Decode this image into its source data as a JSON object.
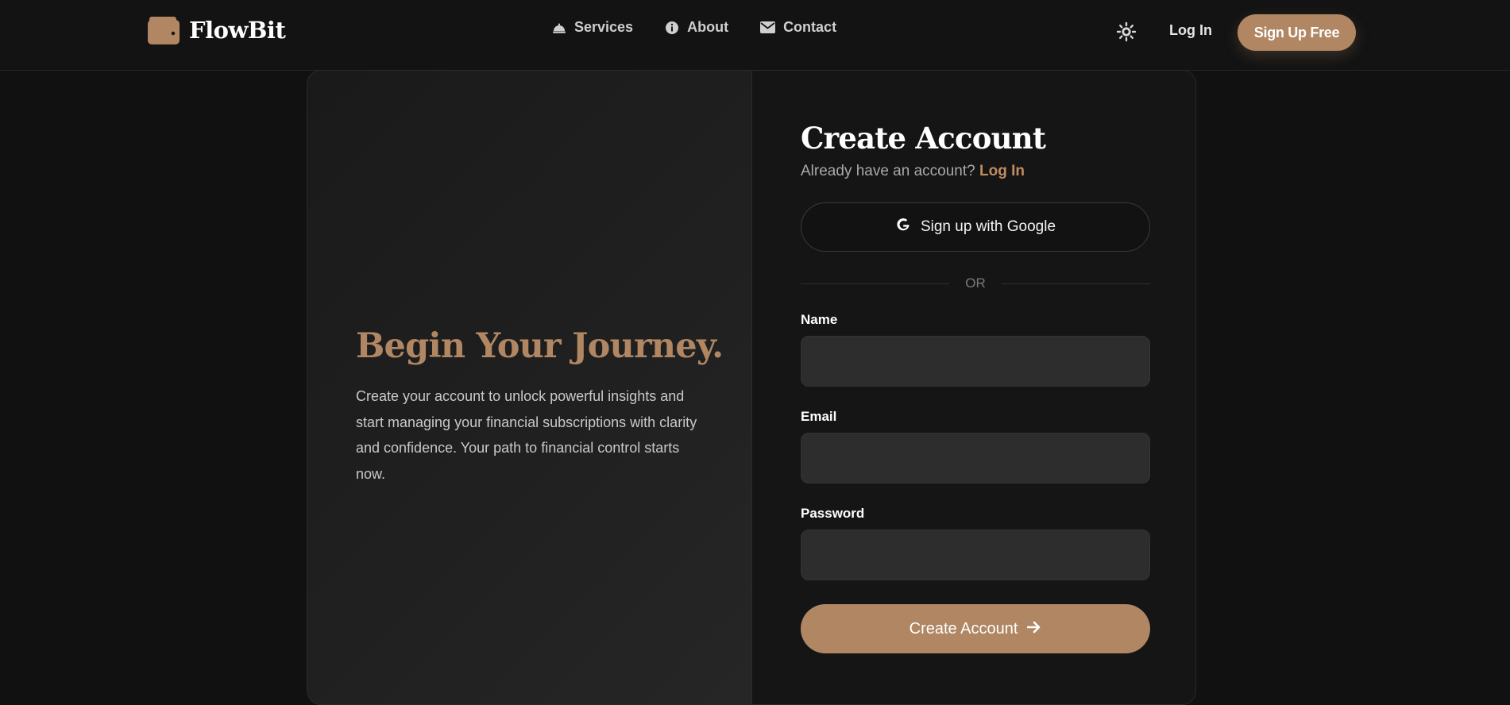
{
  "brand": {
    "name": "FlowBit",
    "icon": "wallet-icon",
    "accent_color": "#b08663"
  },
  "nav": {
    "items": [
      {
        "label": "Services",
        "icon": "bell-service-icon"
      },
      {
        "label": "About",
        "icon": "info-circle-icon"
      },
      {
        "label": "Contact",
        "icon": "envelope-icon"
      }
    ],
    "theme_toggle_icon": "sun-icon",
    "login_label": "Log In",
    "signup_label": "Sign Up Free"
  },
  "hero": {
    "title": "Begin Your Journey.",
    "text": "Create your account to unlock powerful insights and start managing your financial subscriptions with clarity and confidence. Your path to financial control starts now."
  },
  "form": {
    "title": "Create Account",
    "login_prompt": "Already have an account?",
    "login_link": "Log In",
    "google_label": "Sign up with Google",
    "google_icon": "google-icon",
    "divider_label": "OR",
    "fields": [
      {
        "label": "Name",
        "value": ""
      },
      {
        "label": "Email",
        "value": ""
      },
      {
        "label": "Password",
        "value": ""
      }
    ],
    "submit_label": "Create Account",
    "submit_icon": "arrow-right-icon"
  }
}
